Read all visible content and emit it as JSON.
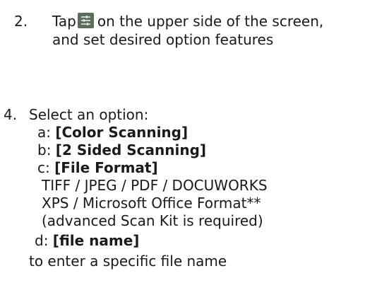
{
  "step2": {
    "number": "2.",
    "tap_word": "Tap",
    "icon_name": "settings-sliders-icon",
    "line1_rest": "on the upper side of the screen,",
    "line2": "and set desired option features"
  },
  "step4": {
    "number": "4.",
    "intro": "Select an option:",
    "options": [
      {
        "prefix": "a:",
        "label": "[Color Scanning]"
      },
      {
        "prefix": "b:",
        "label": "[2 Sided Scanning]"
      },
      {
        "prefix": "c:",
        "label": "[File Format]"
      },
      {
        "prefix": "d:",
        "label": "[file name]"
      }
    ],
    "file_format_lines": [
      "TIFF / JPEG / PDF / DOCUWORKS",
      "XPS / Microsoft Office Format**",
      "(advanced Scan Kit is required)"
    ],
    "file_name_note": "to enter a specific file name"
  },
  "colors": {
    "text": "#1a1a1a",
    "icon_background": "#5b6e5c"
  }
}
